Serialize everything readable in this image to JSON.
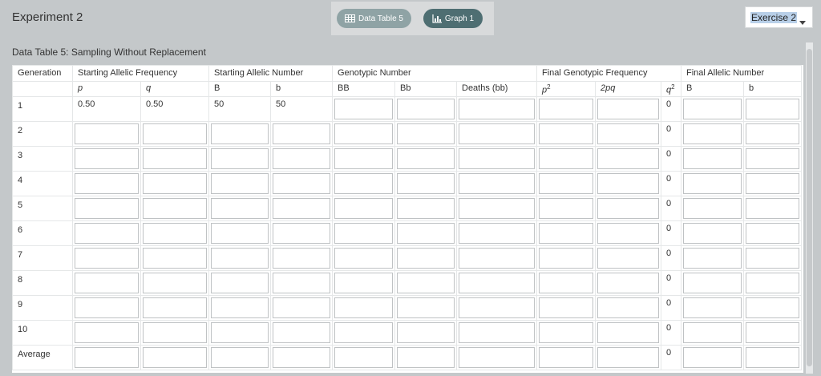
{
  "header": {
    "title": "Experiment 2",
    "tabs": [
      {
        "label": "Data Table 5",
        "icon": "table-icon"
      },
      {
        "label": "Graph 1",
        "icon": "chart-icon"
      }
    ],
    "exercise_select": {
      "value": "Exercise 2"
    }
  },
  "table": {
    "title": "Data Table 5: Sampling Without Replacement",
    "group_headers": {
      "generation": "Generation",
      "starting_allelic_frequency": "Starting Allelic Frequency",
      "starting_allelic_number": "Starting Allelic Number",
      "genotypic_number": "Genotypic Number",
      "final_genotype_frequency": "Final Genotypic Frequency",
      "final_allelic_number": "Final Allelic Number"
    },
    "sub_headers": {
      "p": "p",
      "q": "q",
      "B": "B",
      "b": "b",
      "BB": "BB",
      "Bb": "Bb",
      "deaths": "Deaths (bb)",
      "p2_base": "p",
      "p2_exp": "2",
      "two_pq": "2pq",
      "q2_base": "q",
      "q2_exp": "2",
      "final_B": "B",
      "final_b": "b"
    },
    "rows": [
      {
        "label": "1",
        "p": "0.50",
        "q": "0.50",
        "B": "50",
        "b": "50",
        "q2": "0"
      },
      {
        "label": "2",
        "q2": "0"
      },
      {
        "label": "3",
        "q2": "0"
      },
      {
        "label": "4",
        "q2": "0"
      },
      {
        "label": "5",
        "q2": "0"
      },
      {
        "label": "6",
        "q2": "0"
      },
      {
        "label": "7",
        "q2": "0"
      },
      {
        "label": "8",
        "q2": "0"
      },
      {
        "label": "9",
        "q2": "0"
      },
      {
        "label": "10",
        "q2": "0"
      },
      {
        "label": "Average",
        "q2": "0"
      }
    ]
  },
  "colors": {
    "background": "#c4c8ca",
    "tab_inactive": "#8fa3a5",
    "tab_active": "#4e6e72"
  }
}
